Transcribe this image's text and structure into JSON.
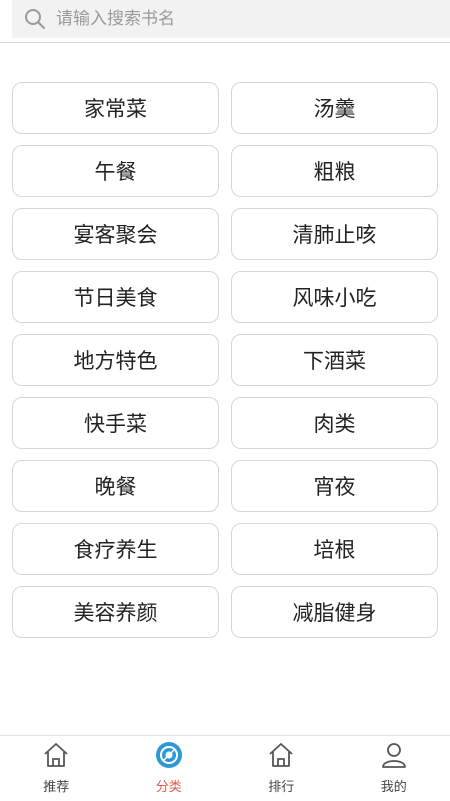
{
  "search": {
    "placeholder": "请输入搜索书名"
  },
  "categories": [
    "家常菜",
    "汤羹",
    "午餐",
    "粗粮",
    "宴客聚会",
    "清肺止咳",
    "节日美食",
    "风味小吃",
    "地方特色",
    "下酒菜",
    "快手菜",
    "肉类",
    "晚餐",
    "宵夜",
    "食疗养生",
    "培根",
    "美容养颜",
    "减脂健身"
  ],
  "tabbar": {
    "tabs": [
      {
        "label": "推荐",
        "icon": "home-icon"
      },
      {
        "label": "分类",
        "icon": "category-icon",
        "active": true
      },
      {
        "label": "排行",
        "icon": "home-icon"
      },
      {
        "label": "我的",
        "icon": "user-icon"
      }
    ]
  },
  "colors": {
    "accent": "#e05a4e",
    "accent_icon": "#2f97d6"
  }
}
